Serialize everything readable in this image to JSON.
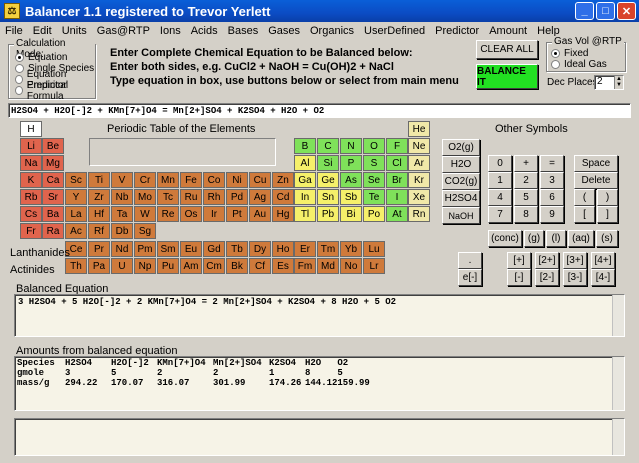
{
  "window": {
    "title": "Balancer 1.1   registered to Trevor Yerlett"
  },
  "menu": [
    "File",
    "Edit",
    "Units",
    "Gas@RTP",
    "Ions",
    "Acids",
    "Bases",
    "Gases",
    "Organics",
    "UserDefined",
    "Predictor",
    "Amount",
    "Help"
  ],
  "calc_mode": {
    "title": "Calculation Mode:",
    "options": [
      "Equation",
      "Single Species",
      "Equation Predictor",
      "Empirical Formula"
    ],
    "selected": 0
  },
  "instructions": [
    "Enter Complete Chemical Equation to be Balanced below:",
    "Enter both sides, e.g. CuCl2 + NaOH = Cu(OH)2 + NaCl",
    "Type equation in box, use buttons below or select from main menu"
  ],
  "buttons": {
    "clear_all": "CLEAR ALL",
    "balance_it": "BALANCE IT"
  },
  "gas_vol": {
    "title": "Gas Vol @RTP",
    "options": [
      "Fixed",
      "Ideal Gas"
    ],
    "selected": 0
  },
  "dec_places": {
    "label": "Dec Places",
    "value": "2"
  },
  "equation_input": "H2SO4 + H2O[-]2 + KMn[7+]O4 = Mn[2+]SO4 + K2SO4 + H2O + O2",
  "periodic_title": "Periodic Table of the Elements",
  "elements": {
    "row1": [
      "H",
      "He"
    ],
    "row2": [
      "Li",
      "Be",
      "B",
      "C",
      "N",
      "O",
      "F",
      "Ne"
    ],
    "row3": [
      "Na",
      "Mg",
      "Al",
      "Si",
      "P",
      "S",
      "Cl",
      "Ar"
    ],
    "row4": [
      "K",
      "Ca",
      "Sc",
      "Ti",
      "V",
      "Cr",
      "Mn",
      "Fe",
      "Co",
      "Ni",
      "Cu",
      "Zn",
      "Ga",
      "Ge",
      "As",
      "Se",
      "Br",
      "Kr"
    ],
    "row5": [
      "Rb",
      "Sr",
      "Y",
      "Zr",
      "Nb",
      "Mo",
      "Tc",
      "Ru",
      "Rh",
      "Pd",
      "Ag",
      "Cd",
      "In",
      "Sn",
      "Sb",
      "Te",
      "I",
      "Xe"
    ],
    "row6": [
      "Cs",
      "Ba",
      "La",
      "Hf",
      "Ta",
      "W",
      "Re",
      "Os",
      "Ir",
      "Pt",
      "Au",
      "Hg",
      "Tl",
      "Pb",
      "Bi",
      "Po",
      "At",
      "Rn"
    ],
    "row7": [
      "Fr",
      "Ra",
      "Ac",
      "Rf",
      "Db",
      "Sg"
    ],
    "lanthanides": [
      "Ce",
      "Pr",
      "Nd",
      "Pm",
      "Sm",
      "Eu",
      "Gd",
      "Tb",
      "Dy",
      "Ho",
      "Er",
      "Tm",
      "Yb",
      "Lu"
    ],
    "actinides": [
      "Th",
      "Pa",
      "U",
      "Np",
      "Pu",
      "Am",
      "Cm",
      "Bk",
      "Cf",
      "Es",
      "Fm",
      "Md",
      "No",
      "Lr"
    ]
  },
  "labels": {
    "lanthanides": "Lanthanides",
    "actinides": "Actinides",
    "other_symbols": "Other Symbols",
    "balanced_equation": "Balanced Equation",
    "amounts": "Amounts from balanced equation"
  },
  "other_symbols": {
    "species": [
      "O2(g)",
      "H2O",
      "CO2(g)",
      "H2SO4",
      "NaOH"
    ],
    "keypad": [
      "0",
      "+",
      "=",
      "1",
      "2",
      "3",
      "4",
      "5",
      "6",
      "7",
      "8",
      "9"
    ],
    "side": [
      "Space",
      "Delete",
      "(",
      ")",
      "[",
      "]"
    ],
    "states": [
      "(conc)",
      "(g)",
      "(l)",
      "(aq)",
      "(s)"
    ],
    "charges": [
      "[+]",
      "[2+]",
      "[3+]",
      "[4+]",
      "[-]",
      "[2-]",
      "[3-]",
      "[4-]"
    ],
    "dot": ".",
    "electron": "e[-]"
  },
  "balanced_equation": "3 H2SO4 + 5 H2O[-]2 + 2 KMn[7+]O4  = 2 Mn[2+]SO4 + K2SO4 + 8 H2O + 5 O2",
  "amounts": {
    "header": [
      "Species",
      "H2SO4",
      "H2O[-]2",
      "KMn[7+]O4",
      "Mn[2+]SO4",
      "K2SO4",
      "H2O",
      "O2"
    ],
    "rows": [
      [
        "gmole",
        "3",
        "5",
        "2",
        "2",
        "1",
        "8",
        "5"
      ],
      [
        "mass/g",
        "294.22",
        "170.07",
        "316.07",
        "301.99",
        "174.26",
        "144.12",
        "159.99"
      ]
    ]
  }
}
